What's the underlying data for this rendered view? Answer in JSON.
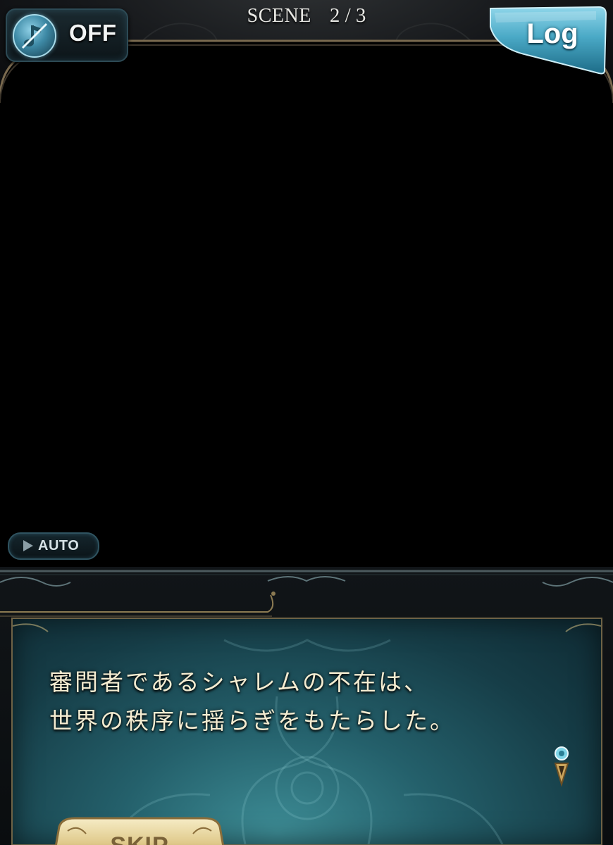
{
  "top_bar": {
    "music_toggle": {
      "state": "OFF",
      "icon": "music-note-muted-icon"
    },
    "scene": {
      "label": "SCENE",
      "count": "2 / 3"
    },
    "log_button": {
      "label": "Log"
    }
  },
  "controls": {
    "auto_button": {
      "label": "AUTO",
      "icon": "play-triangle-icon"
    },
    "skip_button": {
      "label": "SKIP"
    }
  },
  "dialogue": {
    "lines": [
      "審問者であるシャレムの不在は、",
      "世界の秩序に揺らぎをもたらした。"
    ],
    "next_indicator_icon": "next-page-pendant-icon"
  },
  "colors": {
    "background": "#000000",
    "dialogue_text": "#f4ecd1",
    "panel_teal": "#24606b",
    "frame_gold": "#8b7a52",
    "log_button_blue": "#4aa9c6"
  }
}
